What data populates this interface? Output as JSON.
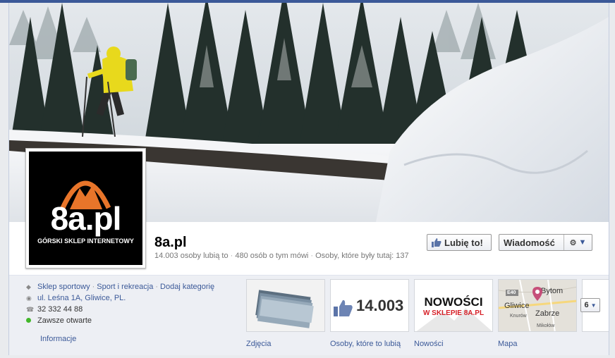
{
  "page": {
    "name": "8a.pl",
    "stats": {
      "likes": "14.003 osoby lubią to",
      "talking": "480 osób o tym mówi",
      "visited": "Osoby, które były tutaj: 137"
    }
  },
  "logo": {
    "text": "8a.pl",
    "subtitle": "GÓRSKI SKLEP INTERNETOWY"
  },
  "actions": {
    "like_label": "Lubię to!",
    "message_label": "Wiadomość"
  },
  "about": {
    "categories": [
      "Sklep sportowy",
      "Sport i rekreacja",
      "Dodaj kategorię"
    ],
    "address": "ul. Leśna 1A, Gliwice, PL.",
    "phone": "32 332 44 88",
    "hours": "Zawsze otwarte",
    "info_link": "Informacje"
  },
  "apps": [
    {
      "label": "Zdjęcia"
    },
    {
      "label": "Osoby, które to lubią",
      "count": "14.003"
    },
    {
      "label": "Nowości",
      "banner_line1": "NOWOŚCI",
      "banner_line2": "W SKLEPIE 8A.PL"
    },
    {
      "label": "Mapa",
      "map_places": [
        "Bytom",
        "Gliwice",
        "Zabrze",
        "Knurów",
        "Mikołów",
        "E40"
      ]
    }
  ],
  "more_apps_count": "6",
  "colors": {
    "brand": "#3b5998",
    "logo_orange": "#e8752a",
    "nowosci_red": "#d61f26"
  }
}
